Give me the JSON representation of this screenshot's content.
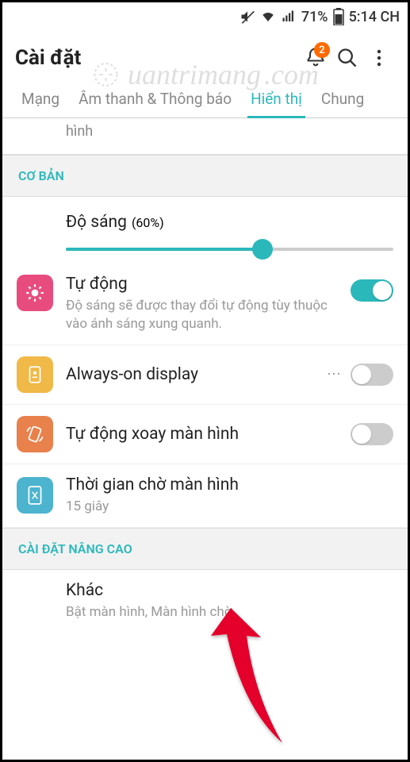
{
  "status_bar": {
    "battery_percent": "71%",
    "time": "5:14 CH"
  },
  "header": {
    "title": "Cài đặt",
    "notification_count": "2"
  },
  "tabs": {
    "tab1": "Mạng",
    "tab2": "Âm thanh & Thông báo",
    "tab3": "Hiển thị",
    "tab4": "Chung"
  },
  "truncated": {
    "text": "hình"
  },
  "sections": {
    "basic": "CƠ BẢN",
    "advanced": "CÀI ĐẶT NÂNG CAO"
  },
  "brightness": {
    "title": "Độ sáng",
    "percent": "(60%)"
  },
  "auto": {
    "title": "Tự động",
    "sub": "Độ sáng sẽ được thay đổi tự động tùy thuộc vào ánh sáng xung quanh."
  },
  "always_on": {
    "title": "Always-on display"
  },
  "auto_rotate": {
    "title": "Tự động xoay màn hình"
  },
  "screen_timeout": {
    "title": "Thời gian chờ màn hình",
    "sub": "15 giây"
  },
  "other": {
    "title": "Khác",
    "sub": "Bật màn hình, Màn hình chờ"
  },
  "watermark": {
    "text": "uantrimang"
  }
}
